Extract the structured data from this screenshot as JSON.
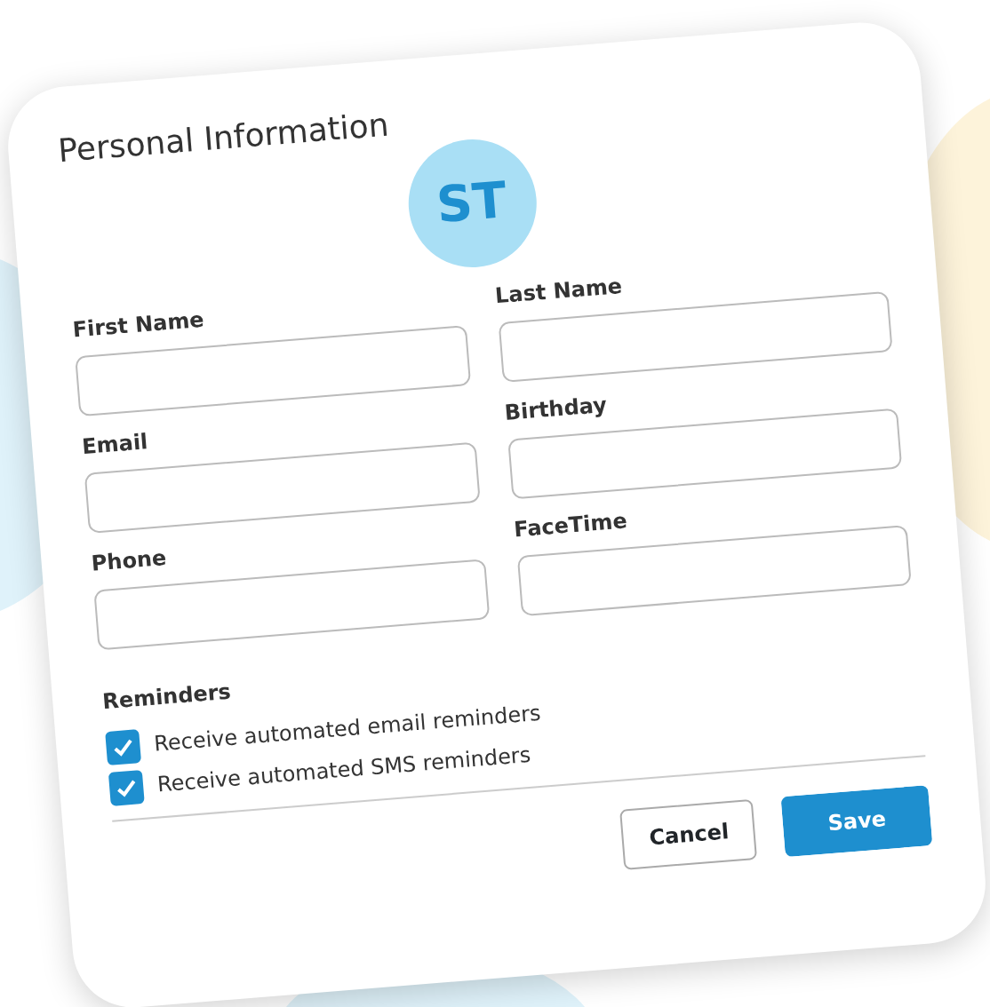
{
  "title": "Personal Information",
  "avatar": {
    "initials": "ST"
  },
  "fields": [
    {
      "label": "First Name"
    },
    {
      "label": "Last Name"
    },
    {
      "label": "Email"
    },
    {
      "label": "Birthday"
    },
    {
      "label": "Phone"
    },
    {
      "label": "FaceTime"
    }
  ],
  "reminders": {
    "label": "Reminders",
    "options": [
      {
        "label": "Receive automated email reminders",
        "checked": true
      },
      {
        "label": "Receive automated SMS reminders",
        "checked": true
      }
    ]
  },
  "buttons": [
    {
      "label": "Cancel",
      "kind": "secondary"
    },
    {
      "label": "Save",
      "kind": "primary"
    }
  ]
}
